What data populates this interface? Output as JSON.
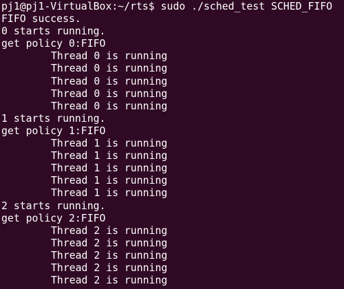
{
  "terminal": {
    "prompt": "pj1@pj1-VirtualBox:~/rts$",
    "command": "sudo ./sched_test SCHED_FIFO",
    "lines": [
      "FIFO success.",
      "0 starts running.",
      "get policy 0:FIFO",
      "Thread 0 is running",
      "Thread 0 is running",
      "Thread 0 is running",
      "Thread 0 is running",
      "Thread 0 is running",
      "1 starts running.",
      "get policy 1:FIFO",
      "Thread 1 is running",
      "Thread 1 is running",
      "Thread 1 is running",
      "Thread 1 is running",
      "Thread 1 is running",
      "2 starts running.",
      "get policy 2:FIFO",
      "Thread 2 is running",
      "Thread 2 is running",
      "Thread 2 is running",
      "Thread 2 is running",
      "Thread 2 is running"
    ]
  },
  "colors": {
    "background": "#300a24",
    "text": "#ffffff"
  }
}
